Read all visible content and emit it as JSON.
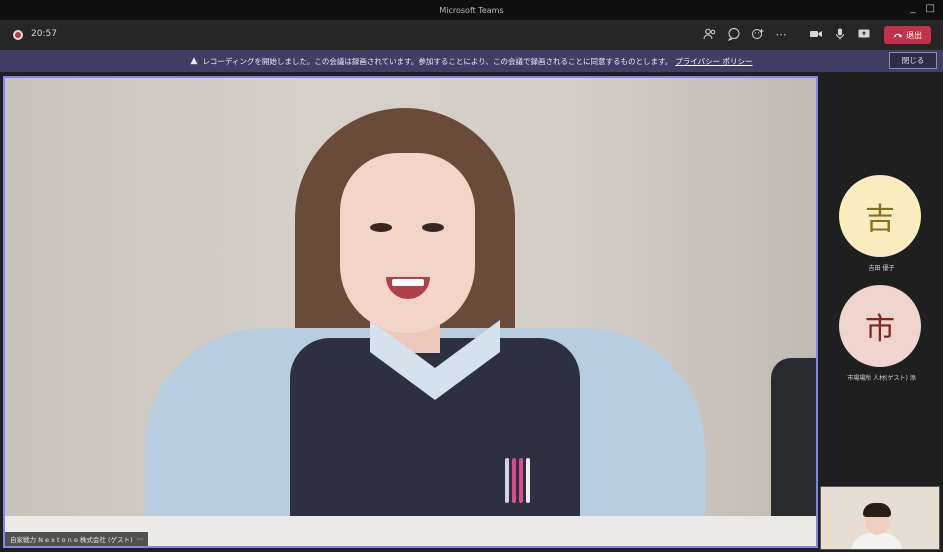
{
  "window": {
    "title": "Microsoft Teams",
    "controls": [
      "minimize-icon",
      "maximize-icon"
    ]
  },
  "toolbar": {
    "timer": "20:57",
    "leave_label": "退出",
    "icons": [
      "participants-icon",
      "chat-icon",
      "reactions-icon",
      "more-icon",
      "camera-icon",
      "mic-icon",
      "share-icon"
    ]
  },
  "banner": {
    "message": "レコーディングを開始しました。この会議は録画されています。参加することにより、この会議で録画されることに同意するものとします。",
    "link": "プライバシー ポリシー",
    "close_label": "閉じる"
  },
  "stage": {
    "name_tag": "自家戦力 N e x t o n e 株式会社 (ゲスト)",
    "name_tag_more": "⋯"
  },
  "roster": [
    {
      "initial": "吉",
      "name": "吉田 優子",
      "color": "#fbedc0",
      "text_color": "#8a6d1e"
    },
    {
      "initial": "市",
      "name": "市場場所 人材(ゲスト) 添",
      "color": "#f0d5cf",
      "text_color": "#7a2a22"
    }
  ],
  "colors": {
    "accent": "#7f85f5",
    "leave": "#c4314b",
    "banner": "#3f3f66"
  }
}
